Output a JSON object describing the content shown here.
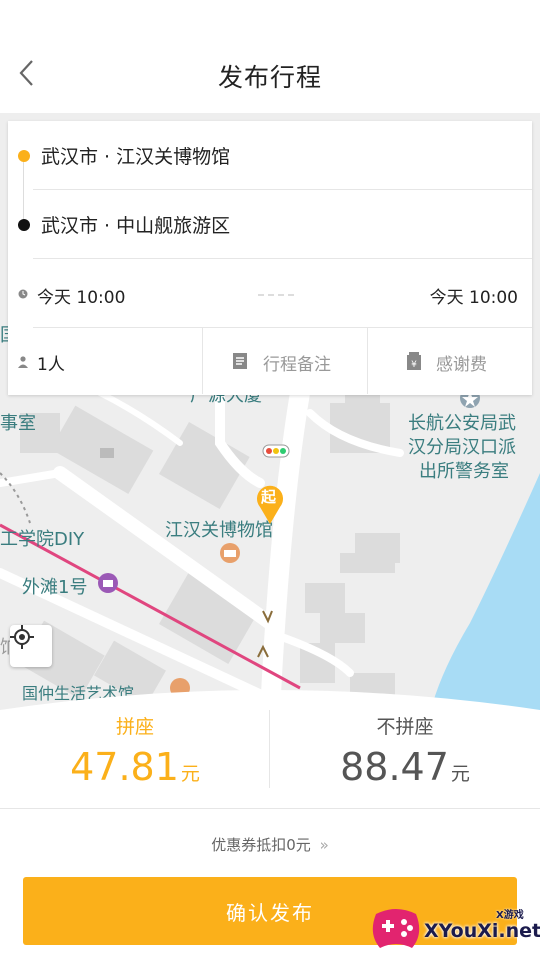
{
  "header": {
    "title": "发布行程",
    "back_icon": "chevron-left-icon"
  },
  "map": {
    "labels": {
      "tourist_center": "广源大厦",
      "police_station_line1": "长航公安局武",
      "police_station_line2": "汉分局汉口派",
      "police_station_line3": "出所警务室",
      "museum": "江汉关博物馆",
      "school": "工学院DIY",
      "waitan": "外滩1号",
      "guozhong": "国仲生活艺术馆",
      "left_edge_room": "事室",
      "left_edge_char": "国",
      "left_edge_char2": "饷"
    },
    "start_marker": "起",
    "colors": {
      "water": "#a8dcf5",
      "road": "#ffffff",
      "route_pink": "#e0467f",
      "building": "#d9d9d9",
      "label": "#3a7d7f"
    }
  },
  "trip": {
    "origin": "武汉市 · 江汉关博物馆",
    "destination": "武汉市 · 中山舰旅游区",
    "depart_time": "今天 10:00",
    "arrive_time": "今天 10:00",
    "passengers": "1人",
    "notes_label": "行程备注",
    "tip_label": "感谢费",
    "colors": {
      "origin_dot": "#fbb01a",
      "destination_dot": "#111111"
    }
  },
  "pricing": {
    "carpool_label": "拼座",
    "carpool_price": "47.81",
    "no_carpool_label": "不拼座",
    "no_carpool_price": "88.47",
    "unit": "元",
    "coupon_text": "优惠券抵扣0元",
    "coupon_arrow": "»",
    "confirm_label": "确认发布",
    "colors": {
      "accent": "#fbb01a",
      "dark": "#555555"
    }
  },
  "watermark": {
    "brand": "XYouXi.net",
    "small": "X游戏"
  }
}
